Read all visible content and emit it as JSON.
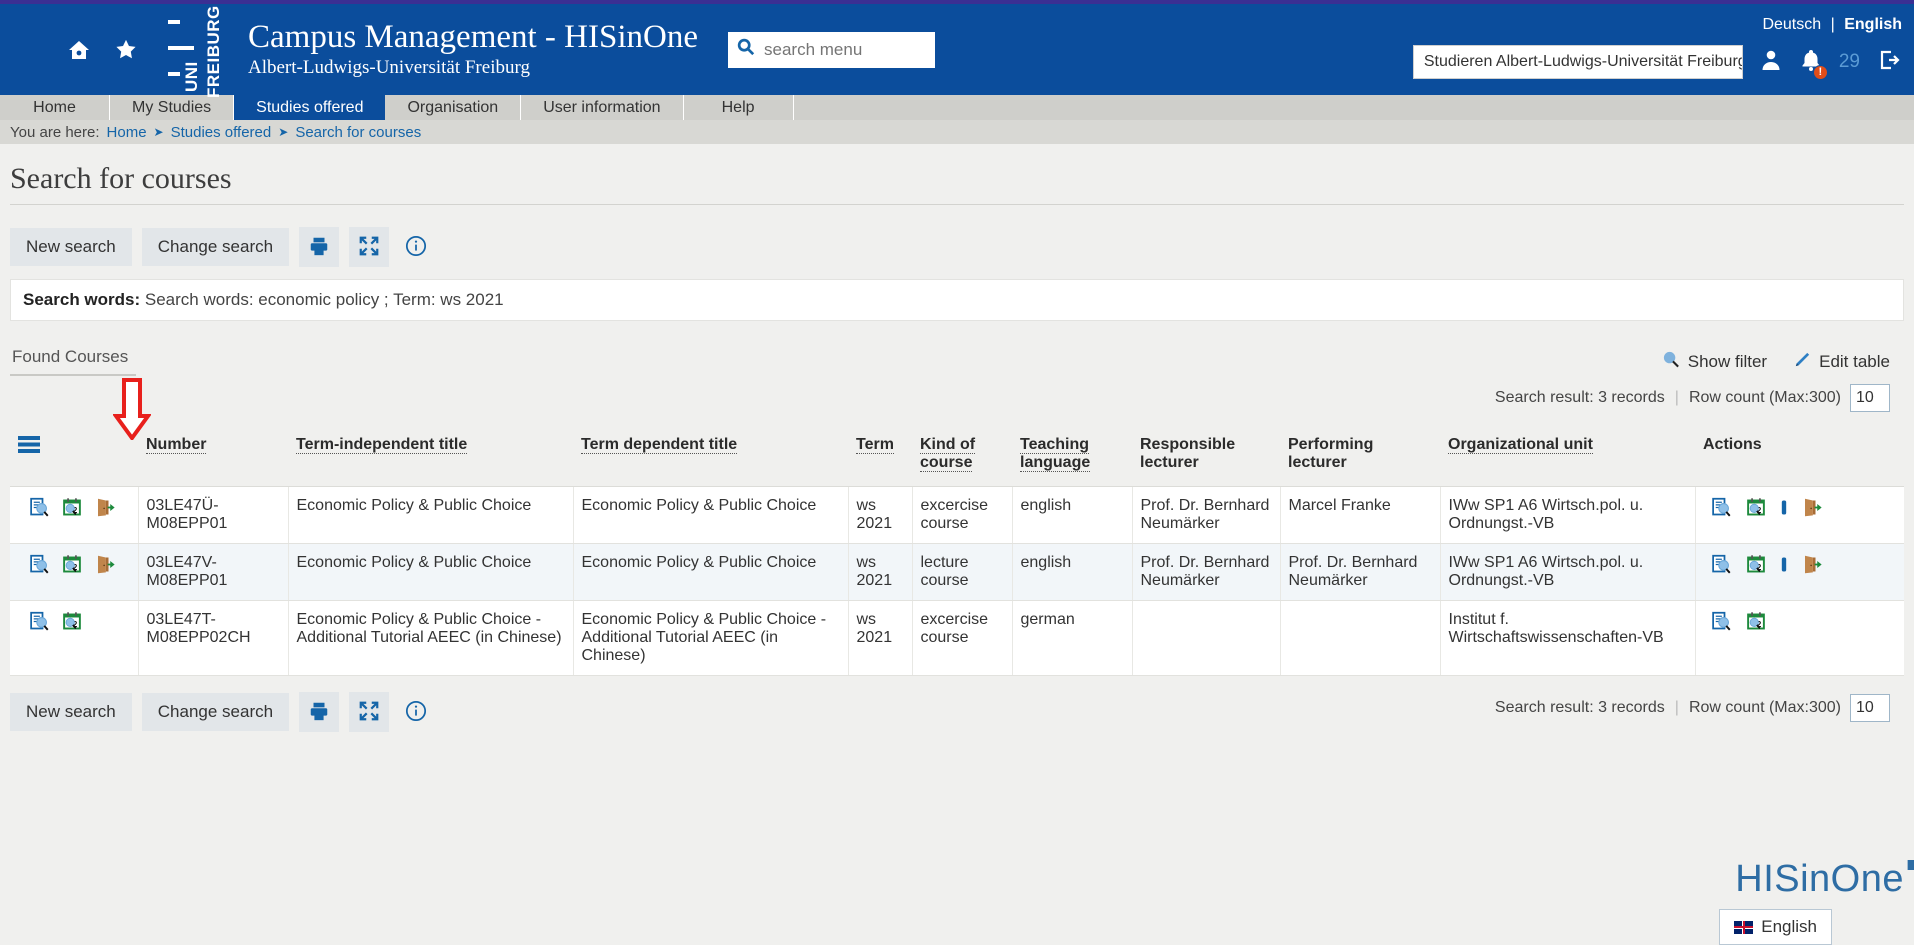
{
  "header": {
    "app_title": "Campus Management - HISinOne",
    "subtitle": "Albert-Ludwigs-Universität Freiburg",
    "logo_text_uni": "UNI",
    "logo_text_freiburg": "FREIBURG",
    "search_placeholder": "search menu",
    "search_value": "",
    "lang_de": "Deutsch",
    "lang_sep": "|",
    "lang_en": "English",
    "org_select_value": "Studieren Albert-Ludwigs-Universität Freiburg",
    "notification_badge": "!",
    "message_count": "29",
    "accent_blue": "#0b4d9c",
    "top_stripe": "#3b2f93"
  },
  "nav": {
    "tabs": [
      {
        "label": "Home",
        "selected": false
      },
      {
        "label": "My Studies",
        "selected": false
      },
      {
        "label": "Studies offered",
        "selected": true
      },
      {
        "label": "Organisation",
        "selected": false
      },
      {
        "label": "User information",
        "selected": false
      },
      {
        "label": "Help",
        "selected": false
      }
    ]
  },
  "breadcrumb": {
    "prefix": "You are here:",
    "items": [
      "Home",
      "Studies offered",
      "Search for courses"
    ]
  },
  "page": {
    "title": "Search for courses",
    "toolbar": {
      "new_search": "New search",
      "change_search": "Change search",
      "print_icon": "printer-icon",
      "expand_icon": "expand-icon",
      "info_icon": "info-icon"
    },
    "search_words": {
      "label": "Search words:",
      "value": "Search words: economic policy ;  Term: ws 2021"
    },
    "results_tab": "Found Courses",
    "show_filter": "Show filter",
    "edit_table": "Edit table",
    "search_result": "Search result: 3 records",
    "row_count_label": "Row count (Max:300)",
    "row_count_value": "10"
  },
  "table": {
    "columns": [
      {
        "label": "",
        "sortable": false
      },
      {
        "label": "",
        "sortable": false
      },
      {
        "label": "Number",
        "sortable": true
      },
      {
        "label": "Term-independent title",
        "sortable": true
      },
      {
        "label": "Term dependent title",
        "sortable": true
      },
      {
        "label": "Term",
        "sortable": true
      },
      {
        "label": "Kind of course",
        "sortable": true
      },
      {
        "label": "Teaching language",
        "sortable": true
      },
      {
        "label": "Responsible lecturer",
        "sortable": false
      },
      {
        "label": "Performing lecturer",
        "sortable": false
      },
      {
        "label": "Organizational unit",
        "sortable": true
      },
      {
        "label": "Actions",
        "sortable": false
      }
    ],
    "rows": [
      {
        "row_icons": [
          "course-detail-icon",
          "schedule-icon",
          "enrol-door-icon"
        ],
        "number": "03LE47Ü-M08EPP01",
        "term_independent_title": "Economic Policy & Public Choice",
        "term_dependent_title": "Economic Policy & Public Choice",
        "term": "ws 2021",
        "kind_of_course": "excercise course",
        "teaching_language": "english",
        "responsible_lecturer": "Prof. Dr. Bernhard Neumärker",
        "performing_lecturer": "Marcel Franke",
        "organizational_unit": "IWw SP1 A6 Wirtsch.pol. u. Ordnungst.-VB",
        "actions": [
          "course-detail-icon",
          "schedule-icon",
          "bar-icon",
          "enrol-door-icon"
        ]
      },
      {
        "row_icons": [
          "course-detail-icon",
          "schedule-icon",
          "enrol-door-icon"
        ],
        "number": "03LE47V-M08EPP01",
        "term_independent_title": "Economic Policy & Public Choice",
        "term_dependent_title": "Economic Policy & Public Choice",
        "term": "ws 2021",
        "kind_of_course": "lecture course",
        "teaching_language": "english",
        "responsible_lecturer": "Prof. Dr. Bernhard Neumärker",
        "performing_lecturer": "Prof. Dr. Bernhard Neumärker",
        "organizational_unit": "IWw SP1 A6 Wirtsch.pol. u. Ordnungst.-VB",
        "actions": [
          "course-detail-icon",
          "schedule-icon",
          "bar-icon",
          "enrol-door-icon"
        ]
      },
      {
        "row_icons": [
          "course-detail-icon",
          "schedule-icon"
        ],
        "number": "03LE47T-M08EPP02CH",
        "term_independent_title": "Economic Policy & Public Choice - Additional Tutorial AEEC (in Chinese)",
        "term_dependent_title": "Economic Policy & Public Choice - Additional Tutorial AEEC (in Chinese)",
        "term": "ws 2021",
        "kind_of_course": "excercise course",
        "teaching_language": "german",
        "responsible_lecturer": "",
        "performing_lecturer": "",
        "organizational_unit": "Institut f. Wirtschaftswissenschaften-VB",
        "actions": [
          "course-detail-icon",
          "schedule-icon"
        ]
      }
    ]
  },
  "bottom_toolbar": {
    "new_search": "New search",
    "change_search": "Change search",
    "search_result": "Search result: 3 records",
    "row_count_label": "Row count (Max:300)",
    "row_count_value": "10"
  },
  "footer": {
    "logo_text": "HISinOne",
    "language_button": "English"
  },
  "annotation": {
    "arrow": "red-down-arrow",
    "color": "#e8201c"
  }
}
